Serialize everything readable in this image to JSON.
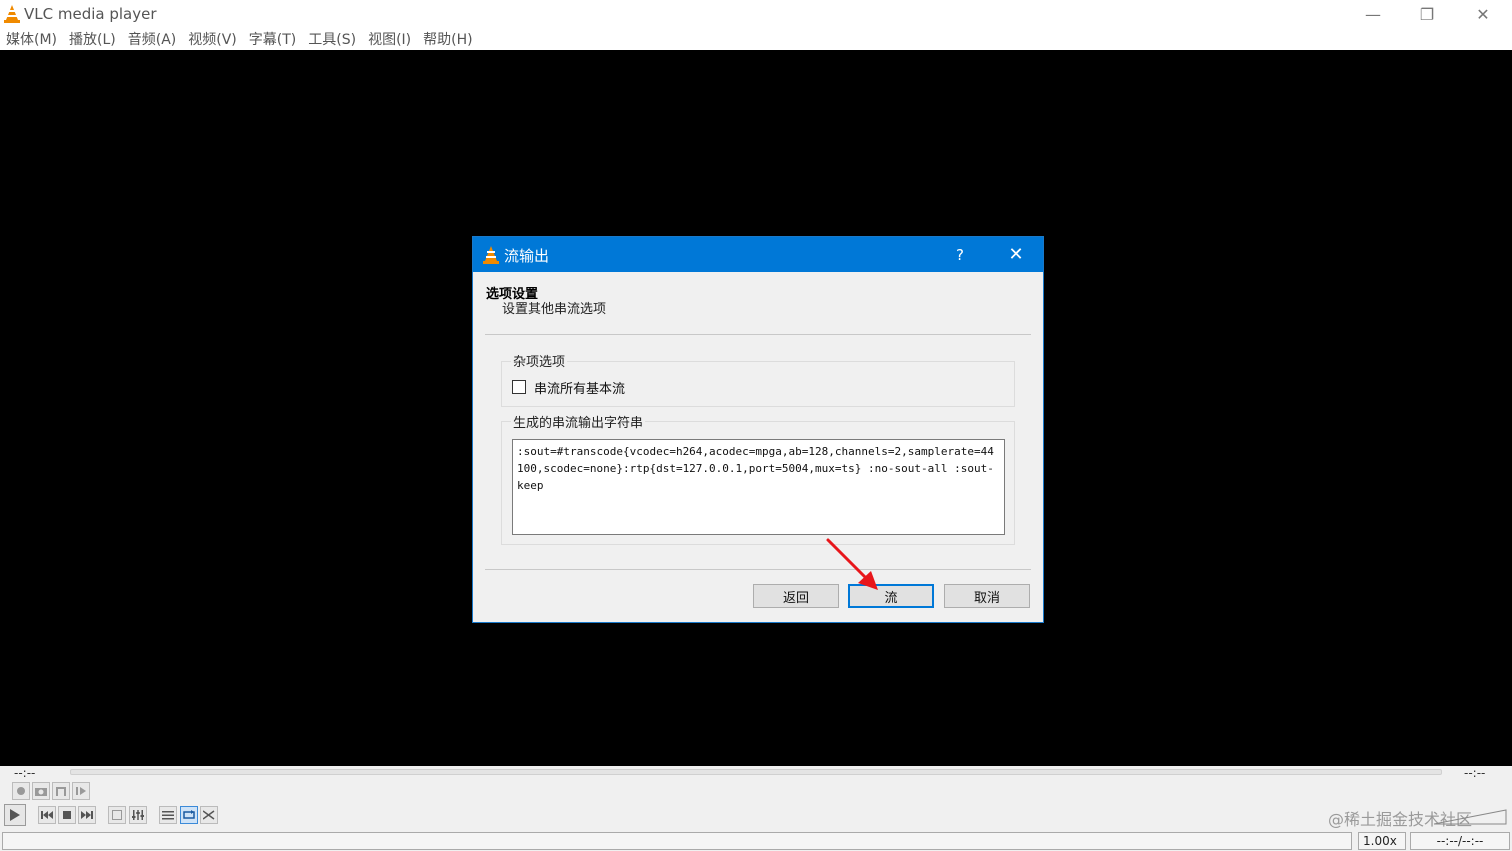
{
  "window": {
    "title": "VLC media player",
    "minimize_glyph": "—",
    "maximize_glyph": "❐",
    "close_glyph": "✕"
  },
  "menu": [
    {
      "label": "媒体(M)"
    },
    {
      "label": "播放(L)"
    },
    {
      "label": "音频(A)"
    },
    {
      "label": "视频(V)"
    },
    {
      "label": "字幕(T)"
    },
    {
      "label": "工具(S)"
    },
    {
      "label": "视图(I)"
    },
    {
      "label": "帮助(H)"
    }
  ],
  "dialog": {
    "title": "流输出",
    "help_glyph": "?",
    "close_glyph": "✕",
    "section_title": "选项设置",
    "section_subtitle": "设置其他串流选项",
    "misc_group_label": "杂项选项",
    "checkbox_label": "串流所有基本流",
    "checkbox_checked": false,
    "mrl_group_label": "生成的串流输出字符串",
    "mrl_text": ":sout=#transcode{vcodec=h264,acodec=mpga,ab=128,channels=2,samplerate=44100,scodec=none}:rtp{dst=127.0.0.1,port=5004,mux=ts} :no-sout-all :sout-keep",
    "buttons": {
      "back": "返回",
      "stream": "流",
      "cancel": "取消"
    }
  },
  "controls": {
    "time_elapsed": "--:--",
    "time_total": "--:--",
    "speed": "1.00x",
    "time_status": "--:--/--:--"
  },
  "watermark": "@稀土掘金技术社区",
  "colors": {
    "accent": "#0078d7",
    "annotation_arrow": "#e8161b",
    "vlc_orange": "#f08a00"
  }
}
